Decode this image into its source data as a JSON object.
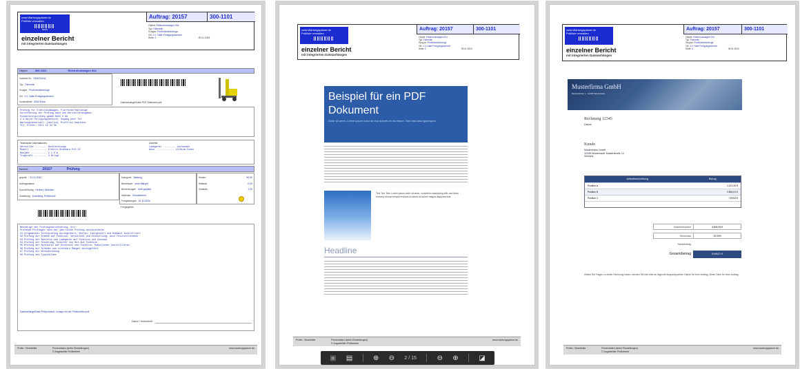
{
  "report": {
    "logo_line1": "www.Wartungsplaner.de",
    "logo_line2": "Prüfliste verwalten",
    "logo_small": "00001",
    "title": "einzelner Bericht",
    "subtitle": "mit integrierten Dateianhängen",
    "auftrag_label": "Auftrag: 20157",
    "auftrag_nr": "300-1101",
    "fields": [
      {
        "k": "Objekt:",
        "v": "Elektrohubwagen 004"
      },
      {
        "k": "Typ:",
        "v": "Fahrzeile"
      },
      {
        "k": "Gruppe:",
        "v": "Flurförderfahrzeuge"
      },
      {
        "k": "Ort:",
        "v": "2.2. Halle Fertigungsbereich"
      },
      {
        "k": "Seite:",
        "v": "1"
      }
    ],
    "date": "09.01.2024",
    "objekt_bar_label": "Objekt",
    "objekt_bar_id": "300-1101",
    "objekt_bar_name": "Elektrohubwagen 004",
    "inventory_fields": [
      {
        "k": "Inventar-Nr.",
        "v": "9458 54444"
      },
      {
        "k": "Typ",
        "v": "Fahrzeile"
      },
      {
        "k": "Gruppe",
        "v": "Flurförderfahrzeuge"
      },
      {
        "k": "Ort",
        "v": "2.2. Halle Fertigungsbereich"
      },
      {
        "k": "Kostenstelle",
        "v": "5254 Edna"
      }
    ],
    "attachment_caption": "Dateianhänge/Datei PDF Ankerwert.pdf",
    "notes": "Prüfung für Elektrohubwagen, Flurförderfahrzeuge\nDurchführung der Prüfung nach den Herstellerangaben\nSicherheitsprüfung gemäß DGUV V 68\n2.4 Halle Fertigungsbereich, Zugang über Tor\nWartungsintervall: jährlich, Prüffrist beachten\nTel. Prüfer: 0471 12 34 56",
    "tech_label": "Technische Informationen",
    "tech_rows": [
      "Hersteller ........ Hochleistungs",
      "Modell ............ Elektro-Standard ELS 10",
      "Baujahr ........... 2 1.0 m",
      "Tragkraft ......... 3 Kilogr."
    ],
    "right_label": "Zubehör",
    "right_rows": [
      "Ladegerät ......... vorhanden",
      "Akku ............. Lithium-Ionen"
    ],
    "bericht_label": "Bericht",
    "bericht_nr": "20157",
    "bericht_status": "Prüfung",
    "status_rows": [
      {
        "k": "geprüft",
        "v": "01.10.2024"
      },
      {
        "k": "Auftragsdatum",
        "v": ""
      },
      {
        "k": "Durchführung",
        "v": "Herbert, Schröder"
      },
      {
        "k": "Zustellung",
        "v": "Zustellung, Prüfbericht"
      }
    ],
    "kategorie_rows": [
      {
        "k": "Kategorie",
        "v": "Wartung"
      },
      {
        "k": "Betriebsart",
        "v": "ohne Mängel"
      },
      {
        "k": "Bemerkungen",
        "v": "nicht geplant"
      },
      {
        "k": "Kalender",
        "v": "Einsatzbereit"
      },
      {
        "k": "Freigabeorgan",
        "v": "01.10.2024"
      }
    ],
    "kosten_rows": [
      {
        "k": "Kosten",
        "v": "80.00"
      },
      {
        "k": "Material",
        "v": "0.00"
      },
      {
        "k": "Zeitaufw.",
        "v": "1.00"
      }
    ],
    "freigabe_label": "Freigegeben",
    "checklist": "Bestätigt der Prüfungsdurchführung, Ort:\nPrüfende Prüfungen nach der jährlichen Prüfung durchzuführen\n01 Allgemeiner Sichtprüfung durchgeführt, Reifen, Fahrgestell und Hubmast kontrolliert\n02 Prüfung der Bremse auf Funktion, Verschleiß und Einstellung, auch Feststellbremse\n03 Prüfung der Batterie und Ladegerät auf Funktion und Zustand\n04 Prüfung der Steuerung, Schalter und Not-Aus Funktion\n05 Prüfung der Hydraulik auf Dichtheit und Funktion, Hubzylinder kontrollieren\n06 Prüfung auf Schäden und sichtbare Mängel durchgeführt\n07 Prüfung der Kennzeichnung\n08 Prüfung des Typschildes",
    "attachment_link": "Dateianhänge/Datei Prüfprotokoll, Vorlage mit der Prüfschritten.pdf",
    "sign_label": "Datum / Unterschrift",
    "footer_left": "Prüfer / Bearbeiter",
    "footer_mid1": "Firmendaten (siehe Einstellungen)",
    "footer_mid2": "© Angestellter Prüfbetrieb",
    "footer_right": "www.wartungsplaner.de"
  },
  "pdf_page": {
    "banner_title": "Beispiel für ein PDF Dokument",
    "banner_sub": "Dolor sit amet. Lorem ipsum dolor sit duo dolores et ea rebum. Stet clita kasd gubergren",
    "sidebox_text": "Text Text Text. Lorem ipsum dolor sit amet, consetetur sadipscing elitr, sed diam nonumy eirmod tempor invidunt ut labore et dolore magna aliquyam erat.",
    "headline": "Headline"
  },
  "viewer_toolbar": {
    "save_icon": "save-icon",
    "print_icon": "print-icon",
    "page_current": "2",
    "page_total": "/ 15"
  },
  "invoice": {
    "company": "Musterfirma GmbH",
    "company_sub": "Musterstraße 1 · 12345 Musterstadt",
    "title": "Rechnung 12345",
    "date": "Datum",
    "kunde_label": "Kunde",
    "kunde_lines": [
      "Mustermann GmbH",
      "12345 Musterstadt, Musterstraße 12",
      "Schweiz"
    ],
    "col_desc": "Artikelbeschreibung",
    "col_amount": "Betrag",
    "rows": [
      {
        "d": "Position A",
        "a": "1.221,00 €"
      },
      {
        "d": "Position B",
        "a": "2.854,01 €"
      },
      {
        "d": "Position C",
        "a": "729,93 €"
      }
    ],
    "sum_rows": [
      {
        "l": "Zwischensumme",
        "r": "4.804,94 €"
      },
      {
        "l": "Steuersatz",
        "r": "19,00%"
      },
      {
        "l": "Steuerbetrag",
        "r": ""
      }
    ],
    "total_label": "Gesamtbetrag",
    "total_value": "5.696,37 €",
    "closing": "Zahlen Sie Fragen zu dieser Rechnung haben, wenden Sie sich bitte an folgende Ansprechpartner. Danke für Ihren Auftrag. Vielen Dank für Ihren Auftrag."
  },
  "colors": {
    "accent_blue": "#1a2bd0",
    "section_lavender": "#b8bef8",
    "pdf_banner": "#2c5ba8",
    "invoice_header": "#2c4a80"
  }
}
